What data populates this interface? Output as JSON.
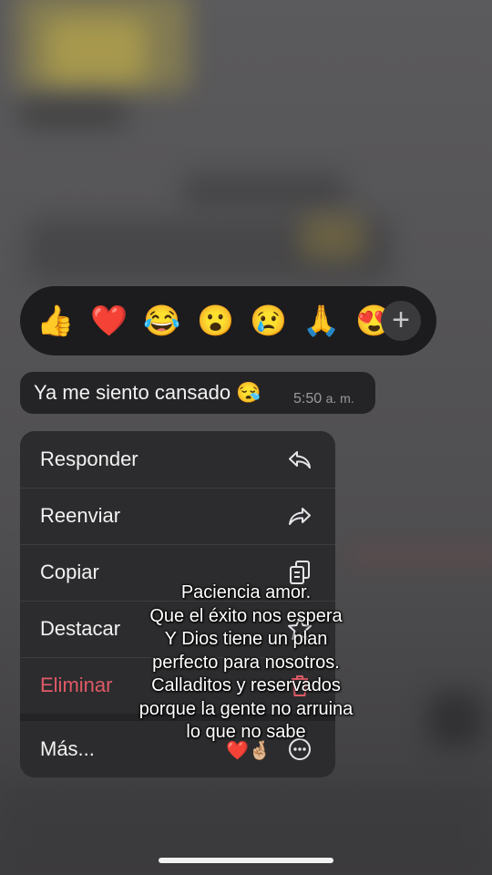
{
  "reactions": {
    "emojis": [
      "👍",
      "❤️",
      "😂",
      "😮",
      "😢",
      "🙏",
      "😍"
    ],
    "add_icon": "plus-icon",
    "add_glyph": "+"
  },
  "message": {
    "text": "Ya me siento cansado 😪",
    "time": "5:50",
    "ampm": "a. m."
  },
  "menu": {
    "items": [
      {
        "label": "Responder",
        "icon": "reply-icon"
      },
      {
        "label": "Reenviar",
        "icon": "forward-icon"
      },
      {
        "label": "Copiar",
        "icon": "copy-icon"
      },
      {
        "label": "Destacar",
        "icon": "star-icon"
      },
      {
        "label": "Eliminar",
        "icon": "trash-icon",
        "color": "#e05a66"
      },
      {
        "label": "Más...",
        "icon": "more-icon"
      }
    ]
  },
  "caption": {
    "lines": [
      "Paciencia amor.",
      "Que el éxito nos espera",
      "Y Dios tiene un plan",
      "perfecto para nosotros.",
      "Calladitos y reservados",
      "porque la gente no arruina",
      "lo que no sabe"
    ],
    "emoji": "❤️🤞🏼"
  },
  "colors": {
    "danger": "#e05a66",
    "menu_bg": "#2c2c2e",
    "bubble_bg": "#242426"
  }
}
